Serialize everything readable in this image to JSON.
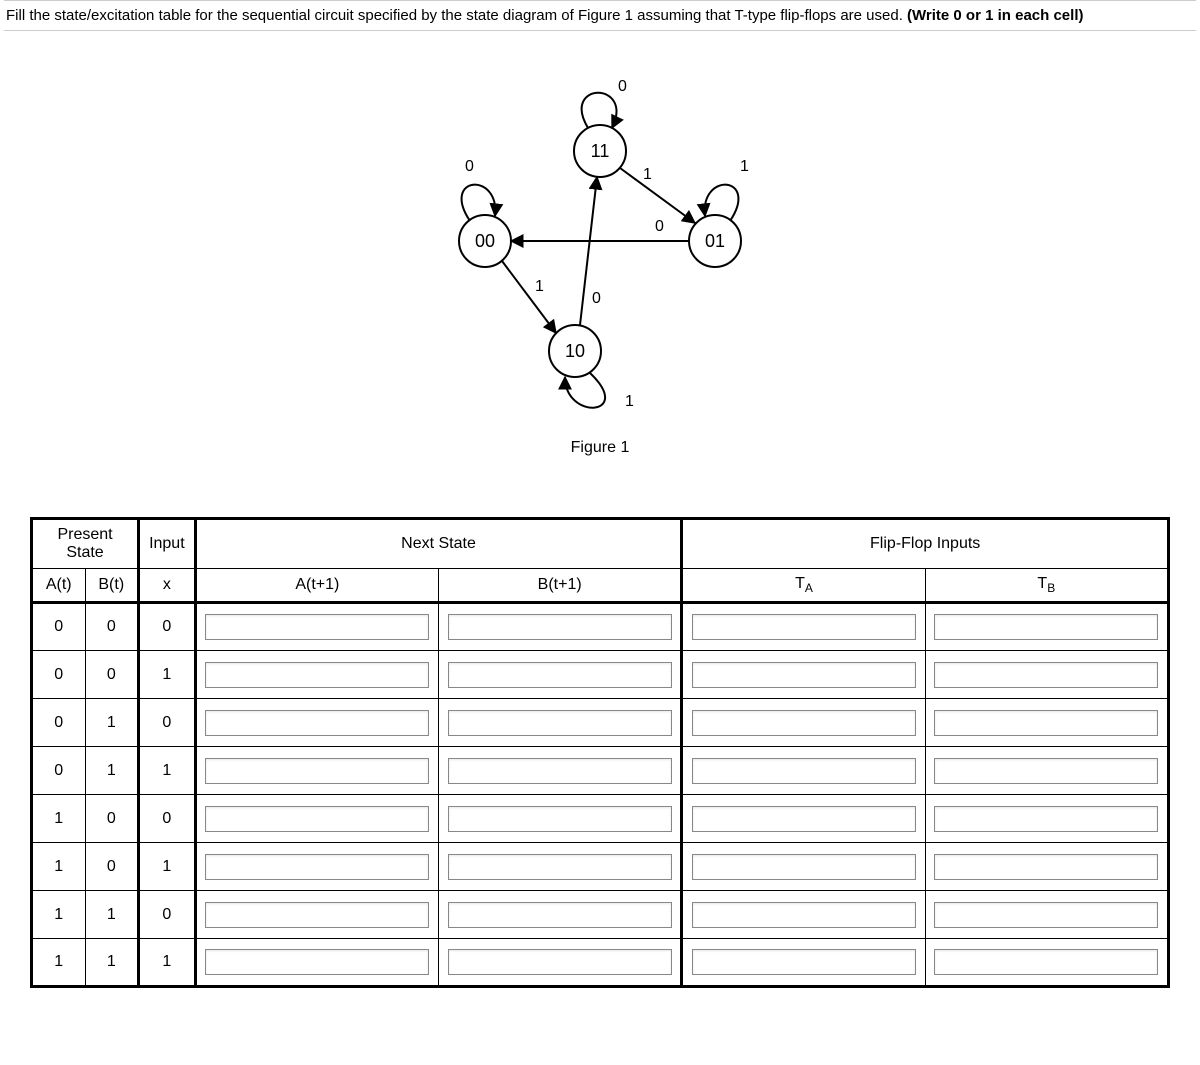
{
  "instruction": {
    "text": "Fill the state/excitation table for the sequential circuit specified by the state diagram of Figure 1 assuming that T-type flip-flops are used.  ",
    "bold": "(Write 0 or 1 in each cell)"
  },
  "diagram": {
    "states": [
      "00",
      "01",
      "10",
      "11"
    ],
    "edge_labels": [
      "0",
      "0",
      "1",
      "1",
      "0",
      "0",
      "1",
      "1"
    ],
    "caption": "Figure 1"
  },
  "table": {
    "group_headers": {
      "present": "Present State",
      "input": "Input",
      "next": "Next State",
      "ff": "Flip-Flop Inputs"
    },
    "col_headers": {
      "a": "A(t)",
      "b": "B(t)",
      "x": "x",
      "an": "A(t+1)",
      "bn": "B(t+1)",
      "ta_base": "T",
      "ta_sub": "A",
      "tb_base": "T",
      "tb_sub": "B"
    },
    "rows": [
      {
        "a": "0",
        "b": "0",
        "x": "0"
      },
      {
        "a": "0",
        "b": "0",
        "x": "1"
      },
      {
        "a": "0",
        "b": "1",
        "x": "0"
      },
      {
        "a": "0",
        "b": "1",
        "x": "1"
      },
      {
        "a": "1",
        "b": "0",
        "x": "0"
      },
      {
        "a": "1",
        "b": "0",
        "x": "1"
      },
      {
        "a": "1",
        "b": "1",
        "x": "0"
      },
      {
        "a": "1",
        "b": "1",
        "x": "1"
      }
    ]
  }
}
